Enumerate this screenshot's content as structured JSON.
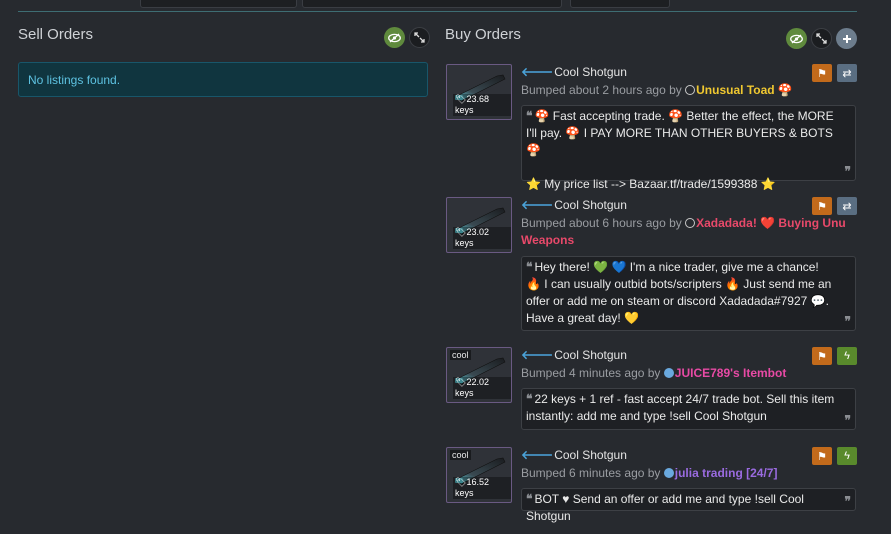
{
  "sell": {
    "title": "Sell Orders",
    "empty_text": "No listings found."
  },
  "buy": {
    "title": "Buy Orders"
  },
  "icons": {
    "eye": "eye-slash-icon",
    "expand": "expand-icon",
    "add": "plus-icon",
    "flag": "flag-icon",
    "swap": "exchange-icon",
    "bolt": "lightning-icon",
    "price_tag": "tag-icon",
    "back_arrow": "arrow-left-icon"
  },
  "colors": {
    "alert_bg": "#10353f",
    "alert_text": "#5ec3e2",
    "green_btn": "#5f8a3d",
    "orange_btn": "#c26a1b"
  },
  "listings": [
    {
      "item": "Cool Shotgun",
      "price": "23.68 keys",
      "note": "",
      "bumped": "Bumped about 2 hours ago by",
      "user": "Unusual Toad",
      "user_suffix": "🍄",
      "user_color": "#f0c830",
      "user_icon": "ring",
      "message_lines": [
        "🍄 Fast accepting trade. 🍄 Better the effect, the MORE I'll pay. 🍄 I PAY MORE THAN OTHER BUYERS & BOTS 🍄",
        "",
        "⭐ My price list --> Bazaar.tf/trade/1599388 ⭐"
      ],
      "action": "swap"
    },
    {
      "item": "Cool Shotgun",
      "price": "23.02 keys",
      "note": "",
      "bumped": "Bumped about 6 hours ago by",
      "user": "Xadadada! ❤️ Buying Unu Weapons",
      "user_suffix": "",
      "user_color": "#e8496a",
      "user_icon": "ring",
      "message_lines": [
        "Hey there! 💚 💙 I'm a nice trader, give me a chance! 🔥 I can usually outbid bots/scripters 🔥 Just send me an offer or add me on steam or discord Xadadada#7927 💬. Have a great day! 💛"
      ],
      "action": "swap"
    },
    {
      "item": "Cool Shotgun",
      "price": "22.02 keys",
      "note": "cool",
      "bumped": "Bumped 4 minutes ago by",
      "user": "JUICE789's Itembot",
      "user_suffix": "",
      "user_color": "#e84aa5",
      "user_icon": "dot",
      "message_lines": [
        "22 keys + 1 ref - fast accept 24/7 trade bot. Sell this item instantly: add me and type !sell Cool Shotgun"
      ],
      "action": "bolt"
    },
    {
      "item": "Cool Shotgun",
      "price": "16.52 keys",
      "note": "cool",
      "bumped": "Bumped 6 minutes ago by",
      "user": "julia trading [24/7]",
      "user_suffix": "",
      "user_color": "#9a6be0",
      "user_icon": "dot",
      "message_lines": [
        "BOT ♥ Send an offer or add me and type !sell Cool Shotgun"
      ],
      "action": "bolt"
    }
  ]
}
